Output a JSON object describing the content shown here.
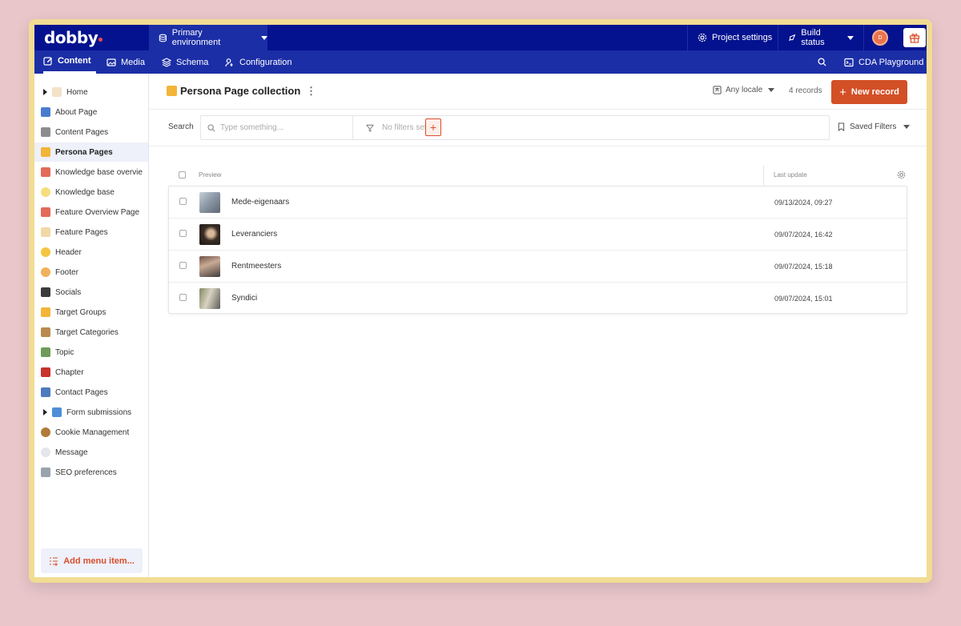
{
  "app": {
    "logo": "dobby",
    "environment": "Primary environment",
    "project_settings": "Project settings",
    "build_status": "Build status",
    "avatar_initial": "D",
    "brand_color": "#04128f",
    "accent_color": "#d34f26"
  },
  "tabs": [
    {
      "label": "Content",
      "icon": "edit-icon",
      "active": true
    },
    {
      "label": "Media",
      "icon": "image-icon",
      "active": false
    },
    {
      "label": "Schema",
      "icon": "layers-icon",
      "active": false
    },
    {
      "label": "Configuration",
      "icon": "config-icon",
      "active": false
    }
  ],
  "cda_playground": "CDA Playground",
  "sidebar": {
    "items": [
      {
        "label": "Home",
        "emoji": "🏡",
        "expandable": true
      },
      {
        "label": "About Page",
        "emoji": "ℹ️"
      },
      {
        "label": "Content Pages",
        "emoji": "🗂"
      },
      {
        "label": "Persona Pages",
        "emoji": "👫",
        "active": true
      },
      {
        "label": "Knowledge base overvie",
        "emoji": "🚁"
      },
      {
        "label": "Knowledge base",
        "emoji": "💡"
      },
      {
        "label": "Feature Overview Page",
        "emoji": "🚁"
      },
      {
        "label": "Feature Pages",
        "emoji": "📜"
      },
      {
        "label": "Header",
        "emoji": "😀"
      },
      {
        "label": "Footer",
        "emoji": "🦶"
      },
      {
        "label": "Socials",
        "emoji": "📱"
      },
      {
        "label": "Target Groups",
        "emoji": "👫"
      },
      {
        "label": "Target Categories",
        "emoji": "📦"
      },
      {
        "label": "Topic",
        "emoji": "📚"
      },
      {
        "label": "Chapter",
        "emoji": "📕"
      },
      {
        "label": "Contact Pages",
        "emoji": "📫"
      },
      {
        "label": "Form submissions",
        "emoji": "📥",
        "expandable": true
      },
      {
        "label": "Cookie Management",
        "emoji": "🍪"
      },
      {
        "label": "Message",
        "emoji": "💬"
      },
      {
        "label": "SEO preferences",
        "emoji": "⛰"
      }
    ],
    "add_menu_item": "Add menu item..."
  },
  "collection": {
    "title": "Persona Page collection",
    "emoji": "👫",
    "locale": "Any locale",
    "record_count": "4 records",
    "new_record": "New record"
  },
  "search": {
    "label": "Search",
    "placeholder": "Type something...",
    "filters": "No filters set",
    "saved_filters": "Saved Filters"
  },
  "table": {
    "columns": [
      "Preview",
      "Last update"
    ],
    "rows": [
      {
        "title": "Mede-eigenaars",
        "date": "09/13/2024, 09:27"
      },
      {
        "title": "Leveranciers",
        "date": "09/07/2024, 16:42"
      },
      {
        "title": "Rentmeesters",
        "date": "09/07/2024, 15:18"
      },
      {
        "title": "Syndici",
        "date": "09/07/2024, 15:01"
      }
    ]
  }
}
